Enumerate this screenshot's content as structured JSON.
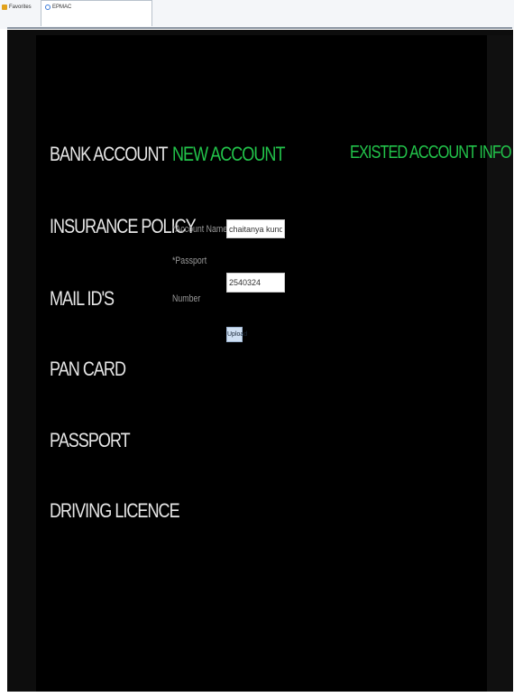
{
  "browser": {
    "favorites_label": "Favorites",
    "tab_label": "EPMAC"
  },
  "sidebar": {
    "items": [
      {
        "label": "BANK ACCOUNT"
      },
      {
        "label": "INSURANCE POLICY"
      },
      {
        "label": "MAIL ID'S"
      },
      {
        "label": "PAN CARD"
      },
      {
        "label": "PASSPORT"
      },
      {
        "label": "DRIVING LICENCE"
      }
    ]
  },
  "main": {
    "tabs": [
      {
        "label": "NEW ACCOUNT"
      },
      {
        "label": "EXISTED ACCOUNT INFO"
      }
    ],
    "form": {
      "account_name_label": "*Account Name",
      "account_name_value": "chaitanya kunda",
      "passport_label_line1": "*Passport",
      "passport_label_line2": "Number",
      "passport_value": "2540324",
      "submit_label": "Upload"
    }
  },
  "colors": {
    "accent": "#22c34a",
    "background": "#000000",
    "nav_text": "#e6e6e6"
  }
}
